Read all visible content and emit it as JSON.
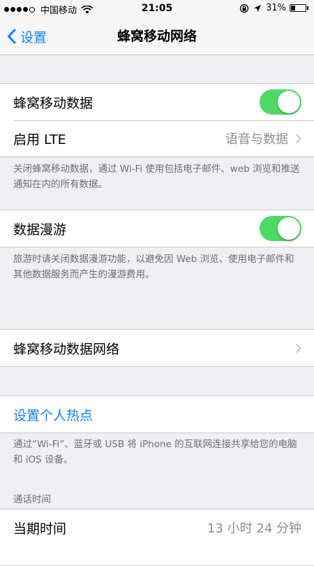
{
  "status_bar": {
    "carrier": "中国移动",
    "time": "21:05",
    "battery_percent": "31%",
    "battery_level": 0.31,
    "signal_bars_filled": 4,
    "signal_bars_total": 5,
    "icons": [
      "wifi-icon",
      "orientation-lock-icon",
      "location-icon",
      "battery-icon"
    ]
  },
  "nav": {
    "back_label": "设置",
    "title": "蜂窝移动网络"
  },
  "cellular": {
    "data_label": "蜂窝移动数据",
    "data_on": true,
    "lte_label": "启用 LTE",
    "lte_value": "语音与数据",
    "footnote": "关闭蜂窝移动数据，通过 Wi-Fi 使用包括电子邮件、web 浏览和推送通知在内的所有数据。"
  },
  "roaming": {
    "label": "数据漫游",
    "on": true,
    "footnote": "旅游时请关闭数据漫游功能，以避免因 Web 浏览、使用电子邮件和其他数据服务而产生的漫游费用。"
  },
  "network": {
    "label": "蜂窝移动数据网络"
  },
  "hotspot": {
    "label": "设置个人热点",
    "footnote": "通过“Wi-Fi”、蓝牙或 USB 将 iPhone 的互联网连接共享给您的电脑和 iOS 设备。"
  },
  "call_time": {
    "header": "通话时间",
    "current_label": "当期时间",
    "current_value": "13 小时 24 分钟"
  },
  "colors": {
    "accent": "#157efb",
    "toggle_on": "#4cd964",
    "background": "#efeff4"
  }
}
